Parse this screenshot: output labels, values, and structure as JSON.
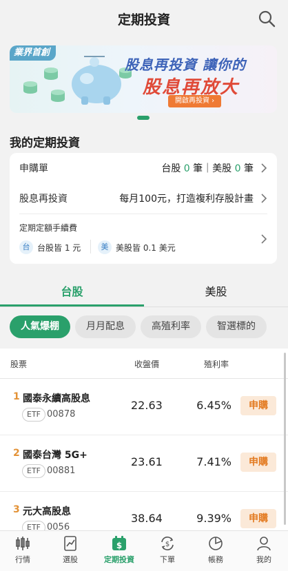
{
  "header": {
    "title": "定期投資"
  },
  "banner": {
    "badge": "業界首創",
    "line1": "股息再投資 讓你的",
    "line2": "股息再放大",
    "cta": "開啟再投資 ›"
  },
  "my_section": {
    "title": "我的定期投資",
    "orders": {
      "label": "申購單",
      "tw_prefix": "台股",
      "tw_count": "0",
      "mid": "筆｜美股",
      "us_count": "0",
      "suffix": "筆"
    },
    "dividend": {
      "label": "股息再投資",
      "value": "每月100元，打造複利存股計畫"
    },
    "fee": {
      "title": "定期定額手續費",
      "tw_chip": "台",
      "tw_text": "台股皆 1 元",
      "us_chip": "美",
      "us_text": "美股皆 0.1 美元"
    }
  },
  "tabs": [
    {
      "label": "台股",
      "active": true
    },
    {
      "label": "美股",
      "active": false
    }
  ],
  "chips": [
    "人氣爆棚",
    "月月配息",
    "高殖利率",
    "智選標的"
  ],
  "list": {
    "headers": {
      "stock": "股票",
      "price": "收盤價",
      "yield": "殖利率"
    },
    "rows": [
      {
        "rank": "1",
        "name": "國泰永續高股息",
        "tag": "ETF",
        "code": "00878",
        "price": "22.63",
        "yield": "6.45%",
        "action": "申購"
      },
      {
        "rank": "2",
        "name": "國泰台灣 5G+",
        "tag": "ETF",
        "code": "00881",
        "price": "23.61",
        "yield": "7.41%",
        "action": "申購"
      },
      {
        "rank": "3",
        "name": "元大高股息",
        "tag": "ETF",
        "code": "0056",
        "price": "38.64",
        "yield": "9.39%",
        "action": "申購"
      }
    ]
  },
  "nav": [
    {
      "label": "行情",
      "icon": "candlestick-icon"
    },
    {
      "label": "選股",
      "icon": "chart-doc-icon"
    },
    {
      "label": "定期投資",
      "icon": "calendar-dollar-icon",
      "active": true
    },
    {
      "label": "下單",
      "icon": "exchange-dollar-icon"
    },
    {
      "label": "帳務",
      "icon": "pie-chart-icon"
    },
    {
      "label": "我的",
      "icon": "user-icon"
    }
  ],
  "colors": {
    "accent": "#2aa06b",
    "orange": "#e37b22",
    "blue_title": "#3d63b8",
    "red_title": "#e04a38"
  }
}
